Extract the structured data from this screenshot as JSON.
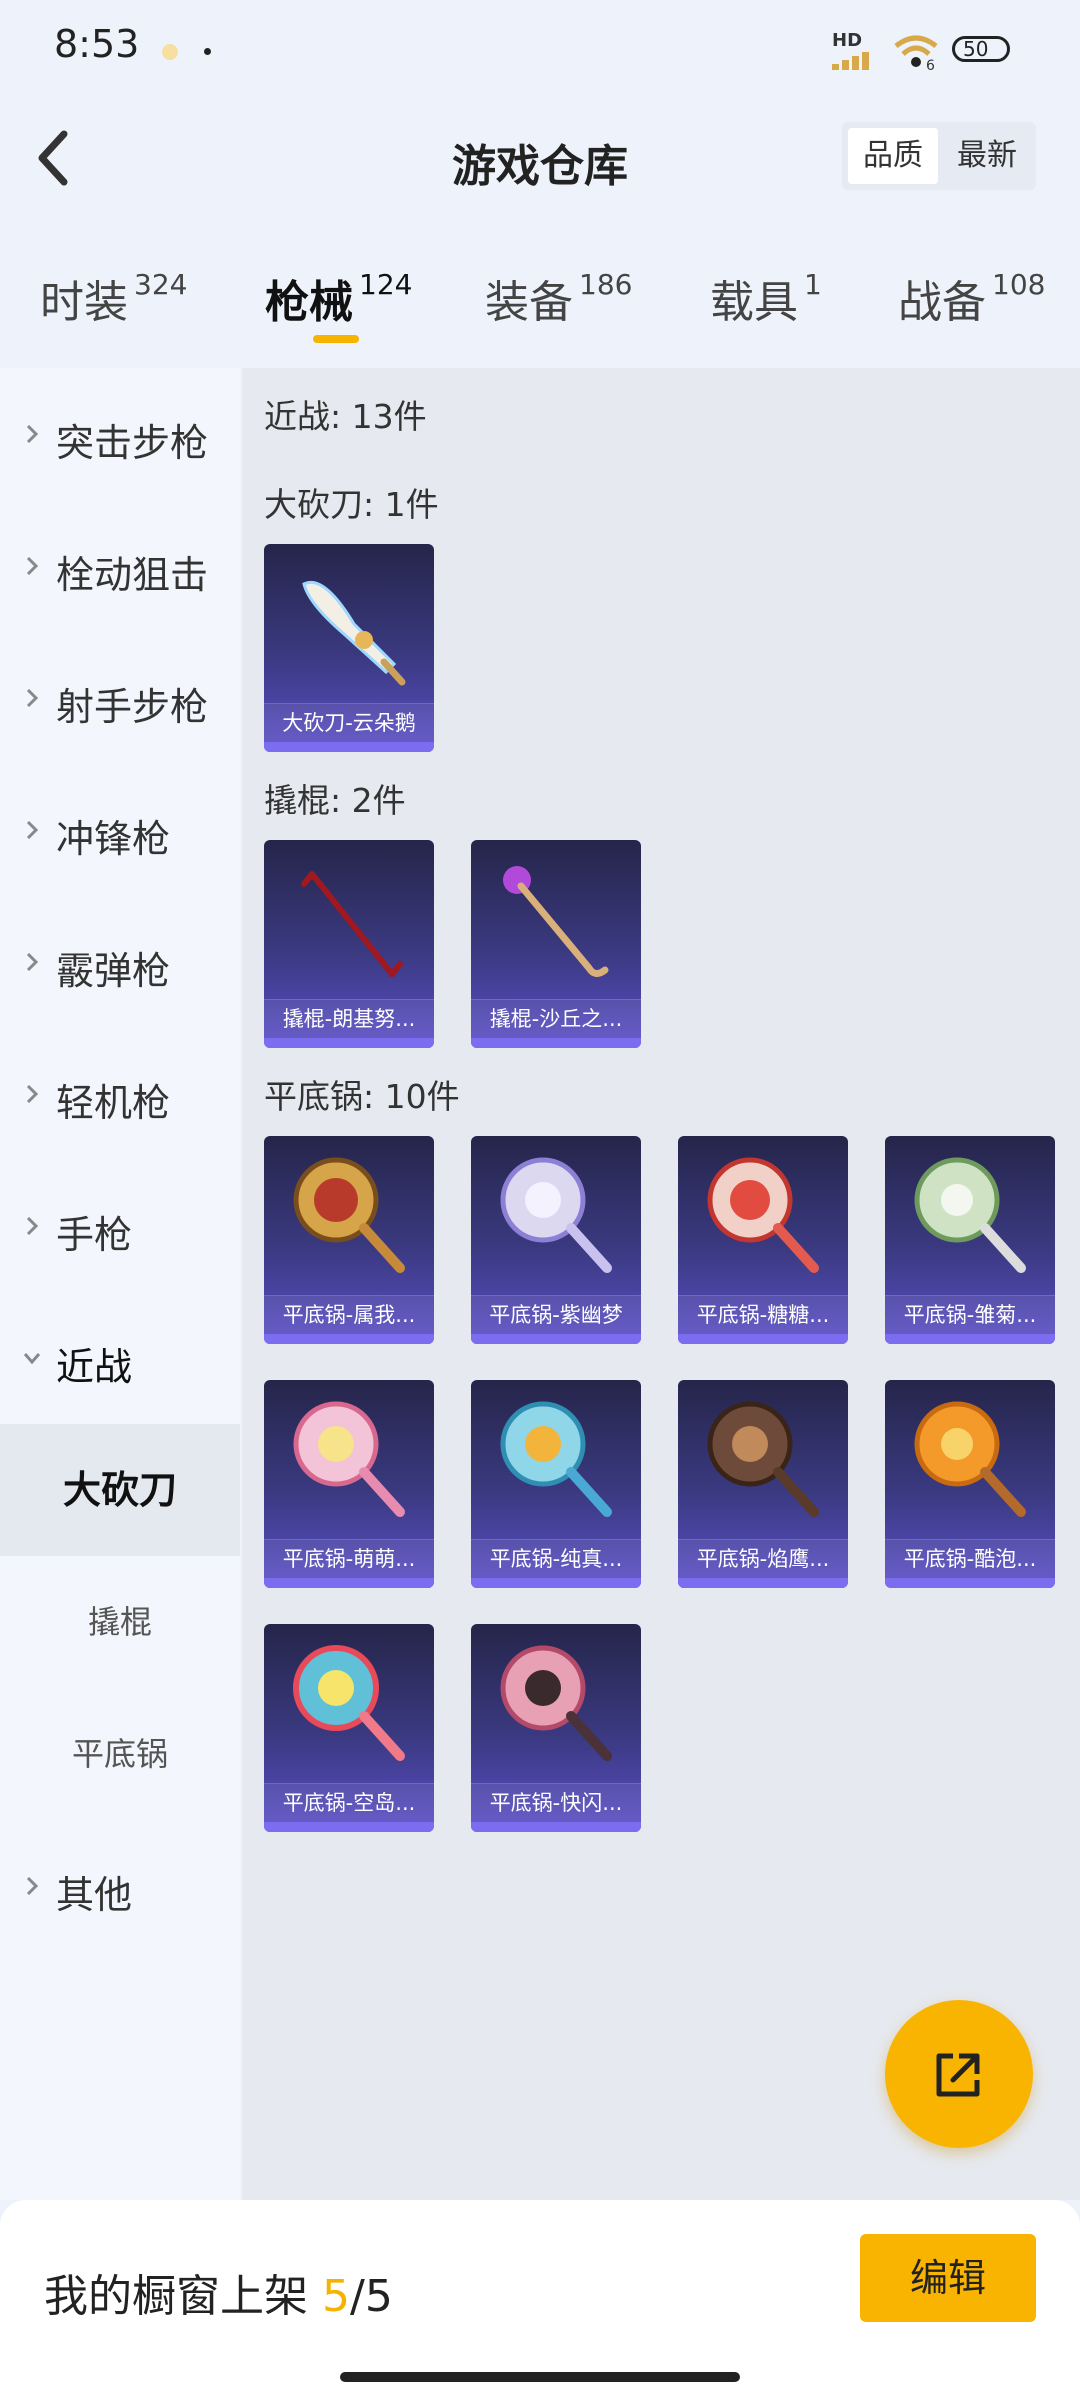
{
  "status_bar": {
    "time": "8:53",
    "hd": "HD",
    "wifi_sub": "6",
    "battery": "50"
  },
  "header": {
    "title": "游戏仓库",
    "sort_options": [
      "品质",
      "最新"
    ]
  },
  "tabs": [
    {
      "label": "时装",
      "count": "324"
    },
    {
      "label": "枪械",
      "count": "124"
    },
    {
      "label": "装备",
      "count": "186"
    },
    {
      "label": "载具",
      "count": "1"
    },
    {
      "label": "战备",
      "count": "108"
    }
  ],
  "sidebar": {
    "categories": [
      "突击步枪",
      "栓动狙击",
      "射手步枪",
      "冲锋枪",
      "霰弹枪",
      "轻机枪",
      "手枪",
      "近战",
      "其他"
    ],
    "subcategories": [
      "大砍刀",
      "撬棍",
      "平底锅"
    ]
  },
  "content": {
    "section_title": "近战: 13件",
    "groups": [
      {
        "title": "大砍刀: 1件",
        "items": [
          "大砍刀-云朵鹅"
        ]
      },
      {
        "title": "撬棍: 2件",
        "items": [
          "撬棍-朗基努...",
          "撬棍-沙丘之..."
        ]
      },
      {
        "title": "平底锅: 10件",
        "items": [
          "平底锅-属我...",
          "平底锅-紫幽梦",
          "平底锅-糖糖...",
          "平底锅-雏菊...",
          "平底锅-萌萌...",
          "平底锅-纯真...",
          "平底锅-焰鹰...",
          "平底锅-酷泡...",
          "平底锅-空岛...",
          "平底锅-快闪..."
        ]
      }
    ]
  },
  "bottom_bar": {
    "label": "我的橱窗上架",
    "current": "5",
    "separator": "/",
    "total": "5",
    "edit_label": "编辑"
  },
  "colors": {
    "accent": "#f8b400",
    "card_top": "#25254a",
    "card_bottom": "#5b4fc9"
  }
}
